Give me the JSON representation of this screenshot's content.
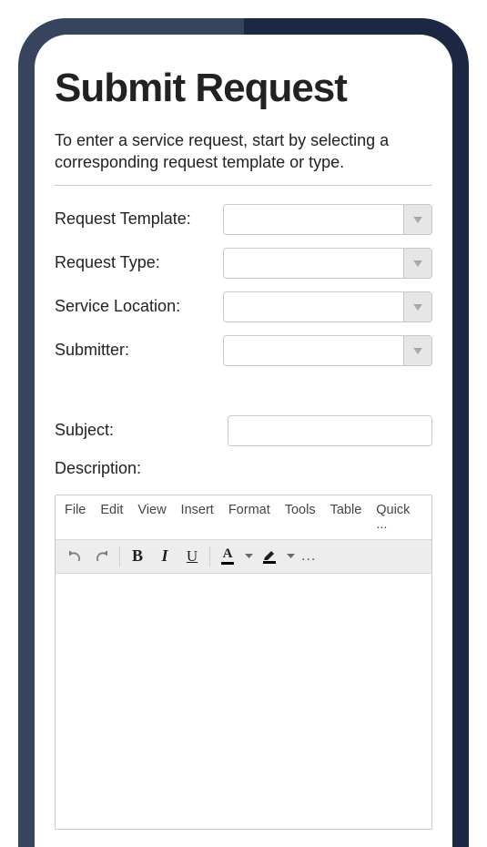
{
  "title": "Submit Request",
  "intro": "To enter a service request, start by selecting a corresponding request template or type.",
  "fields": {
    "template": {
      "label": "Request Template:",
      "value": ""
    },
    "type": {
      "label": "Request Type:",
      "value": ""
    },
    "location": {
      "label": "Service Location:",
      "value": ""
    },
    "submitter": {
      "label": "Submitter:",
      "value": ""
    },
    "subject": {
      "label": "Subject:",
      "value": ""
    },
    "description_label": "Description:"
  },
  "editor": {
    "menus": {
      "file": "File",
      "edit": "Edit",
      "view": "View",
      "insert": "Insert",
      "format": "Format",
      "tools": "Tools",
      "table": "Table",
      "quick": "Quick ..."
    },
    "ellipsis": "..."
  }
}
